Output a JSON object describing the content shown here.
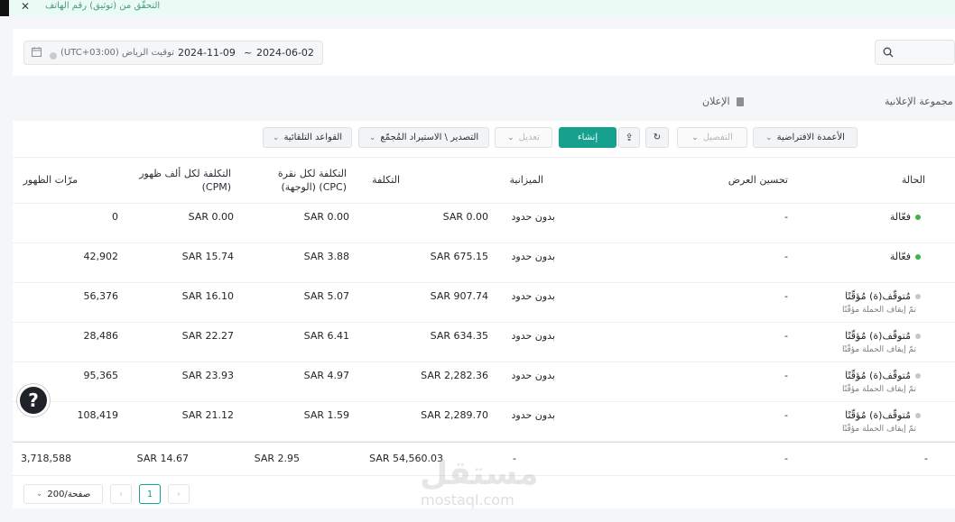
{
  "banner": {
    "text": "التحقّق من (توثيق) رقم الهاتف"
  },
  "filters": {
    "timezone": "(UTC+03:00) توقيت الرياض",
    "date_start": "2024-06-02",
    "date_sep": "~",
    "date_end": "2024-11-09"
  },
  "tabs": {
    "ad": "الإعلان",
    "ad_group": "مجموعة الإعلانية"
  },
  "toolbar": {
    "default_columns": "الأعمدة الافتراضية",
    "details": "التفصيل",
    "create": "إنشاء",
    "edit": "تعديل",
    "export_import": "التصدير \\ الاستيراد المُجمّع",
    "auto_rules": "القواعد التلقائية"
  },
  "columns": {
    "status": "الحالة",
    "optimization": "تحسين العرض",
    "budget": "الميزانية",
    "cost": "التكلفة",
    "cpc_line1": "التكلفة لكل نقرة",
    "cpc_line2": "(الوجهة) (CPC)",
    "cpm_line1": "التكلفة لكل ألف ظهور",
    "cpm_line2": "(CPM)",
    "impressions": "مرّات الظهور"
  },
  "rows": [
    {
      "status": "فعّالة",
      "status_color": "#3bb54a",
      "sub": "",
      "optimization": "-",
      "budget": "بدون حدود",
      "cost": "SAR 0.00",
      "cpc": "SAR 0.00",
      "cpm": "SAR 0.00",
      "impressions": "0"
    },
    {
      "status": "فعّالة",
      "status_color": "#3bb54a",
      "sub": "",
      "optimization": "-",
      "budget": "بدون حدود",
      "cost": "SAR 675.15",
      "cpc": "SAR 3.88",
      "cpm": "SAR 15.74",
      "impressions": "42,902"
    },
    {
      "status": "مُتوقّف(ة) مُؤقّتًا",
      "status_color": "#c4c7cc",
      "sub": "تمّ إيقاف الحملة مؤقّتًا",
      "optimization": "-",
      "budget": "بدون حدود",
      "cost": "SAR 907.74",
      "cpc": "SAR 5.07",
      "cpm": "SAR 16.10",
      "impressions": "56,376"
    },
    {
      "status": "مُتوقّف(ة) مُؤقّتًا",
      "status_color": "#c4c7cc",
      "sub": "تمّ إيقاف الحملة مؤقّتًا",
      "optimization": "-",
      "budget": "بدون حدود",
      "cost": "SAR 634.35",
      "cpc": "SAR 6.41",
      "cpm": "SAR 22.27",
      "impressions": "28,486"
    },
    {
      "status": "مُتوقّف(ة) مُؤقّتًا",
      "status_color": "#c4c7cc",
      "sub": "تمّ إيقاف الحملة مؤقّتًا",
      "optimization": "-",
      "budget": "بدون حدود",
      "cost": "SAR 2,282.36",
      "cpc": "SAR 4.97",
      "cpm": "SAR 23.93",
      "impressions": "95,365"
    },
    {
      "status": "مُتوقّف(ة) مُؤقّتًا",
      "status_color": "#c4c7cc",
      "sub": "تمّ إيقاف الحملة مؤقّتًا",
      "optimization": "-",
      "budget": "بدون حدود",
      "cost": "SAR 2,289.70",
      "cpc": "SAR 1.59",
      "cpm": "SAR 21.12",
      "impressions": "108,419"
    }
  ],
  "totals": {
    "status": "-",
    "optimization": "-",
    "budget": "-",
    "cost": "SAR 54,560.03",
    "cpc": "SAR 2.95",
    "cpm": "SAR 14.67",
    "impressions": "3,718,588"
  },
  "pagination": {
    "page_size": "200/صفحة",
    "current_page": "1"
  },
  "help": {
    "symbol": "?"
  },
  "watermark": {
    "main": "مستقل",
    "sub": "mostaql.com"
  }
}
